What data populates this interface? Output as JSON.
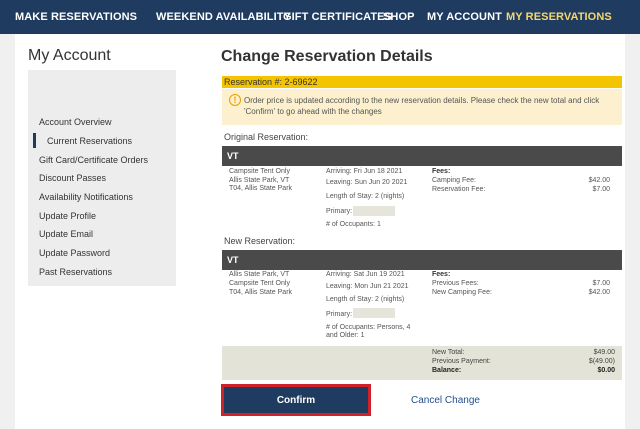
{
  "nav": {
    "items": [
      "MAKE RESERVATIONS",
      "WEEKEND AVAILABILITY",
      "GIFT CERTIFICATES",
      "SHOP",
      "MY ACCOUNT",
      "MY RESERVATIONS"
    ],
    "active_index": 5
  },
  "sidebar": {
    "title": "My Account",
    "items": [
      "Account Overview",
      "Current Reservations",
      "Gift Card/Certificate Orders",
      "Discount Passes",
      "Availability Notifications",
      "Update Profile",
      "Update Email",
      "Update Password",
      "Past Reservations"
    ],
    "active_index": 1
  },
  "main": {
    "title": "Change Reservation Details",
    "reservation_number": "Reservation #: 2-69622",
    "notice": "Order price is updated according to the new reservation details. Please check the new total and click 'Confirm' to go ahead with the changes"
  },
  "original": {
    "label": "Original Reservation:",
    "state": "VT",
    "site": [
      "Campsite Tent Only",
      "Allis State Park, VT",
      "T04, Allis State Park"
    ],
    "arriving": "Arriving: Fri Jun 18 2021",
    "leaving": "Leaving: Sun Jun 20 2021",
    "length": "Length of Stay: 2 (nights)",
    "primary_label": "Primary:",
    "occupants": "# of Occupants: 1",
    "fees_label": "Fees:",
    "fees": [
      {
        "label": "Camping Fee:",
        "value": "$42.00"
      },
      {
        "label": "Reservation Fee:",
        "value": "$7.00"
      }
    ]
  },
  "new": {
    "label": "New Reservation:",
    "state": "VT",
    "site": [
      "Allis State Park, VT",
      "Campsite Tent Only",
      "T04, Allis State Park"
    ],
    "arriving": "Arriving: Sat Jun 19 2021",
    "leaving": "Leaving: Mon Jun 21 2021",
    "length": "Length of Stay: 2 (nights)",
    "primary_label": "Primary:",
    "occupants_line1": "# of Occupants: Persons, 4",
    "occupants_line2": "and Older: 1",
    "fees_label": "Fees:",
    "fees": [
      {
        "label": "Previous Fees:",
        "value": "$7.00"
      },
      {
        "label": "New Camping Fee:",
        "value": "$42.00"
      }
    ]
  },
  "totals": [
    {
      "label": "New Total:",
      "value": "$49.00"
    },
    {
      "label": "Previous Payment:",
      "value": "$(49.00)"
    },
    {
      "label": "Balance:",
      "value": "$0.00"
    }
  ],
  "actions": {
    "confirm": "Confirm",
    "cancel": "Cancel Change"
  },
  "colors": {
    "nav_bg": "#1f3b5f",
    "nav_active": "#f5d76e",
    "reservation_bar": "#f5c400",
    "notice_bg": "#fcf0cf",
    "confirm_border": "#d0202a"
  }
}
